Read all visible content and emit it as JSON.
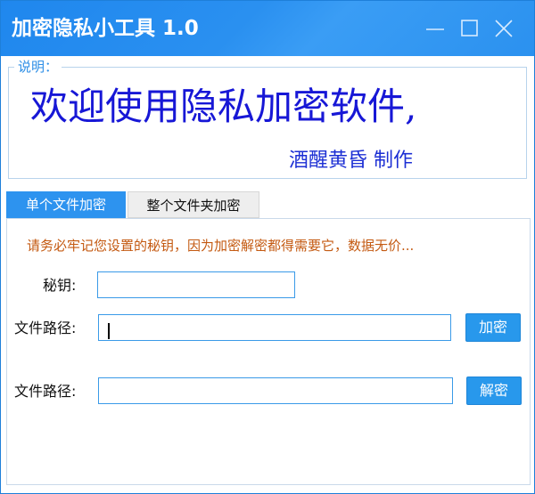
{
  "window": {
    "title": "加密隐私小工具 1.0",
    "controls": {
      "minimize": "minimize-icon",
      "maximize": "maximize-icon",
      "close": "close-icon"
    }
  },
  "intro": {
    "legend": "说明：",
    "welcome": "欢迎使用隐私加密软件,",
    "author": "酒醒黄昏 制作"
  },
  "tabs": [
    {
      "label": "单个文件加密",
      "active": true
    },
    {
      "label": "整个文件夹加密",
      "active": false
    }
  ],
  "form": {
    "warning": "请务必牢记您设置的秘钥，因为加密解密都得需要它，数据无价...",
    "key": {
      "label": "秘钥:",
      "value": ""
    },
    "encrypt": {
      "label": "文件路径:",
      "value": "",
      "button": "加密"
    },
    "decrypt": {
      "label": "文件路径:",
      "value": "",
      "button": "解密"
    }
  },
  "colors": {
    "titlebar": "#2a90f0",
    "accent": "#2898ec",
    "welcome_text": "#1717d6",
    "warning_text": "#c45a12"
  }
}
